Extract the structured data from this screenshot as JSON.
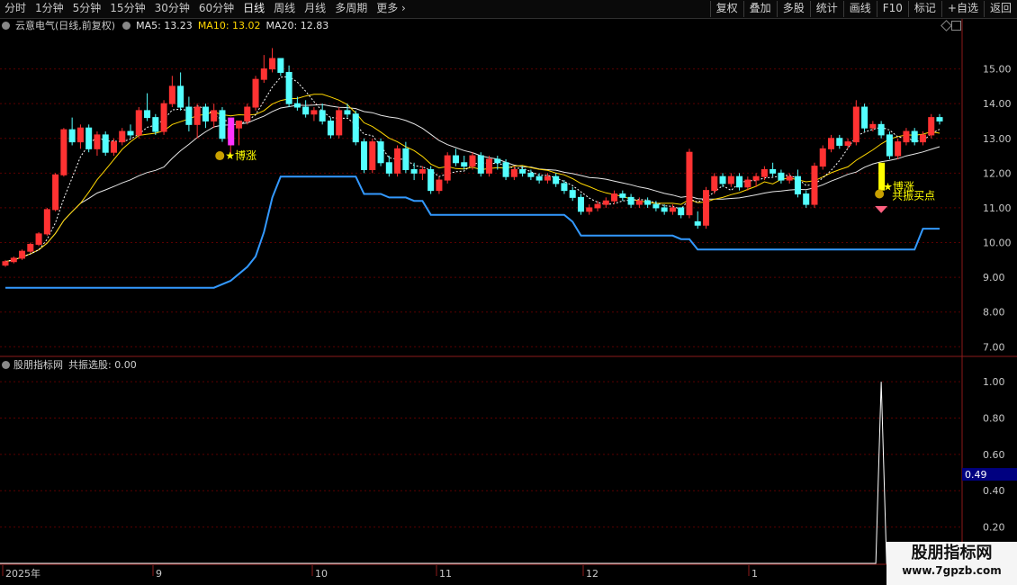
{
  "toolbar": {
    "tabs": [
      "分时",
      "1分钟",
      "5分钟",
      "15分钟",
      "30分钟",
      "60分钟",
      "日线",
      "周线",
      "月线",
      "多周期",
      "更多"
    ],
    "active_tab": "日线",
    "buttons": [
      "复权",
      "叠加",
      "多股",
      "统计",
      "画线",
      "F10",
      "标记",
      "+自选",
      "返回"
    ]
  },
  "info": {
    "stock": "云意电气(日线,前复权)",
    "ma5": "MA5: 13.23",
    "ma10": "MA10: 13.02",
    "ma20": "MA20: 12.83"
  },
  "indicator": {
    "title": "股朋指标网",
    "label": "共振选股: 0.00",
    "current_value": "0.49"
  },
  "price_axis": {
    "ticks": [
      "15.00",
      "14.00",
      "13.00",
      "12.00",
      "11.00",
      "10.00",
      "9.00",
      "8.00",
      "7.00"
    ]
  },
  "ind_axis": {
    "ticks": [
      "1.00",
      "0.80",
      "0.60",
      "0.40",
      "0.20"
    ]
  },
  "date_axis": {
    "labels": [
      "2025年",
      "9",
      "10",
      "11",
      "12",
      "1"
    ]
  },
  "annotations": {
    "signal1": "★博涨",
    "signal2": "★博涨",
    "signal3": "共振买点"
  },
  "watermark": {
    "title": "股朋指标网",
    "url": "www.7gpzb.com"
  },
  "colors": {
    "up": "#ff3232",
    "down": "#54ffff",
    "ma5": "#ffffff",
    "ma10": "#ffd700",
    "support": "#3399ff",
    "grid": "#8b0000"
  },
  "chart_data": {
    "type": "candlestick",
    "ylim": [
      6.8,
      16.0
    ],
    "candles": [
      [
        9.35,
        9.5,
        9.3,
        9.45
      ],
      [
        9.45,
        9.6,
        9.4,
        9.55
      ],
      [
        9.55,
        9.8,
        9.5,
        9.75
      ],
      [
        9.75,
        10.0,
        9.7,
        9.95
      ],
      [
        9.95,
        10.3,
        9.9,
        10.25
      ],
      [
        10.25,
        11.0,
        10.2,
        10.95
      ],
      [
        10.95,
        12.0,
        10.9,
        11.95
      ],
      [
        11.95,
        13.3,
        11.9,
        13.25
      ],
      [
        13.25,
        13.6,
        12.8,
        12.9
      ],
      [
        12.9,
        13.4,
        12.7,
        13.3
      ],
      [
        13.3,
        13.4,
        12.6,
        12.7
      ],
      [
        12.7,
        13.2,
        12.5,
        13.1
      ],
      [
        13.1,
        13.2,
        12.5,
        12.6
      ],
      [
        12.6,
        13.0,
        12.5,
        12.9
      ],
      [
        12.9,
        13.3,
        12.8,
        13.2
      ],
      [
        13.2,
        13.4,
        13.0,
        13.1
      ],
      [
        13.1,
        13.9,
        13.0,
        13.8
      ],
      [
        13.8,
        14.3,
        13.5,
        13.6
      ],
      [
        13.6,
        13.7,
        13.1,
        13.2
      ],
      [
        13.2,
        14.1,
        13.1,
        14.0
      ],
      [
        14.0,
        14.8,
        13.9,
        14.5
      ],
      [
        14.5,
        14.9,
        13.8,
        13.9
      ],
      [
        13.9,
        14.2,
        13.2,
        13.4
      ],
      [
        13.4,
        14.0,
        13.0,
        13.9
      ],
      [
        13.9,
        14.0,
        13.3,
        13.5
      ],
      [
        13.5,
        14.0,
        13.3,
        13.8
      ],
      [
        13.8,
        13.9,
        12.9,
        13.0
      ],
      [
        13.0,
        13.5,
        12.5,
        13.3
      ],
      [
        13.3,
        13.5,
        12.8,
        13.5
      ],
      [
        13.5,
        14.0,
        13.4,
        13.9
      ],
      [
        13.9,
        14.8,
        13.8,
        14.7
      ],
      [
        14.7,
        15.4,
        14.6,
        15.0
      ],
      [
        15.0,
        15.6,
        14.9,
        15.3
      ],
      [
        15.3,
        15.3,
        14.8,
        14.9
      ],
      [
        14.9,
        15.1,
        13.9,
        14.0
      ],
      [
        14.0,
        14.2,
        13.8,
        13.9
      ],
      [
        13.9,
        14.1,
        13.6,
        13.7
      ],
      [
        13.7,
        13.9,
        13.5,
        13.8
      ],
      [
        13.8,
        14.0,
        13.4,
        13.5
      ],
      [
        13.5,
        13.6,
        13.0,
        13.1
      ],
      [
        13.1,
        13.9,
        13.0,
        13.8
      ],
      [
        13.8,
        14.0,
        13.6,
        13.7
      ],
      [
        13.7,
        13.8,
        12.8,
        12.9
      ],
      [
        12.9,
        13.0,
        12.0,
        12.1
      ],
      [
        12.1,
        13.0,
        12.0,
        12.9
      ],
      [
        12.9,
        13.0,
        12.2,
        12.3
      ],
      [
        12.3,
        12.5,
        11.9,
        12.0
      ],
      [
        12.0,
        12.8,
        11.9,
        12.7
      ],
      [
        12.7,
        12.9,
        12.0,
        12.1
      ],
      [
        12.1,
        12.3,
        11.8,
        12.0
      ],
      [
        12.0,
        12.2,
        11.8,
        12.1
      ],
      [
        12.1,
        12.2,
        11.4,
        11.5
      ],
      [
        11.5,
        11.9,
        11.4,
        11.8
      ],
      [
        11.8,
        12.6,
        11.7,
        12.5
      ],
      [
        12.5,
        12.7,
        12.2,
        12.3
      ],
      [
        12.3,
        12.5,
        12.1,
        12.2
      ],
      [
        12.2,
        12.6,
        12.1,
        12.5
      ],
      [
        12.5,
        12.6,
        11.9,
        12.0
      ],
      [
        12.0,
        12.5,
        11.9,
        12.4
      ],
      [
        12.4,
        12.5,
        12.1,
        12.3
      ],
      [
        12.3,
        12.4,
        11.8,
        11.9
      ],
      [
        11.9,
        12.2,
        11.8,
        12.1
      ],
      [
        12.1,
        12.2,
        11.9,
        12.0
      ],
      [
        12.0,
        12.1,
        11.8,
        11.9
      ],
      [
        11.9,
        12.0,
        11.7,
        11.8
      ],
      [
        11.8,
        12.0,
        11.7,
        11.9
      ],
      [
        11.9,
        12.0,
        11.6,
        11.7
      ],
      [
        11.7,
        11.8,
        11.4,
        11.5
      ],
      [
        11.5,
        11.6,
        11.2,
        11.3
      ],
      [
        11.3,
        11.4,
        10.8,
        10.9
      ],
      [
        10.9,
        11.1,
        10.8,
        11.0
      ],
      [
        11.0,
        11.2,
        10.9,
        11.1
      ],
      [
        11.1,
        11.3,
        11.0,
        11.2
      ],
      [
        11.2,
        11.5,
        11.1,
        11.4
      ],
      [
        11.4,
        11.5,
        11.2,
        11.3
      ],
      [
        11.3,
        11.4,
        11.0,
        11.1
      ],
      [
        11.1,
        11.3,
        11.0,
        11.2
      ],
      [
        11.2,
        11.3,
        11.0,
        11.1
      ],
      [
        11.1,
        11.2,
        10.9,
        11.0
      ],
      [
        11.0,
        11.1,
        10.8,
        10.9
      ],
      [
        10.9,
        11.1,
        10.8,
        11.0
      ],
      [
        11.0,
        11.0,
        10.7,
        10.8
      ],
      [
        10.8,
        12.7,
        10.7,
        12.6
      ],
      [
        10.6,
        10.9,
        10.4,
        10.5
      ],
      [
        10.5,
        11.6,
        10.4,
        11.5
      ],
      [
        11.5,
        12.0,
        11.4,
        11.9
      ],
      [
        11.9,
        12.0,
        11.6,
        11.7
      ],
      [
        11.7,
        12.0,
        11.6,
        11.9
      ],
      [
        11.9,
        12.0,
        11.5,
        11.6
      ],
      [
        11.6,
        11.9,
        11.5,
        11.8
      ],
      [
        11.8,
        12.0,
        11.6,
        11.9
      ],
      [
        11.9,
        12.2,
        11.8,
        12.1
      ],
      [
        12.1,
        12.3,
        11.9,
        12.0
      ],
      [
        12.0,
        12.1,
        11.7,
        11.8
      ],
      [
        11.8,
        12.0,
        11.7,
        11.9
      ],
      [
        11.9,
        12.1,
        11.3,
        11.4
      ],
      [
        11.4,
        11.5,
        11.0,
        11.1
      ],
      [
        11.1,
        12.3,
        11.0,
        12.2
      ],
      [
        12.2,
        12.8,
        12.1,
        12.7
      ],
      [
        12.7,
        13.1,
        12.6,
        13.0
      ],
      [
        13.0,
        13.1,
        12.7,
        12.8
      ],
      [
        12.8,
        13.0,
        12.7,
        12.9
      ],
      [
        12.9,
        14.1,
        12.8,
        13.9
      ],
      [
        13.9,
        14.0,
        13.2,
        13.3
      ],
      [
        13.3,
        13.5,
        13.2,
        13.4
      ],
      [
        13.4,
        13.5,
        13.0,
        13.1
      ],
      [
        13.1,
        13.2,
        12.4,
        12.5
      ],
      [
        12.5,
        13.0,
        12.4,
        12.9
      ],
      [
        12.9,
        13.3,
        12.8,
        13.2
      ],
      [
        13.2,
        13.3,
        12.8,
        12.9
      ],
      [
        12.9,
        13.2,
        12.8,
        13.1
      ],
      [
        13.1,
        13.7,
        13.0,
        13.6
      ],
      [
        13.6,
        13.7,
        13.4,
        13.5
      ]
    ],
    "signal_value": 1.0,
    "signal_bar": 105,
    "ind_ylim": [
      0,
      1.05
    ]
  }
}
